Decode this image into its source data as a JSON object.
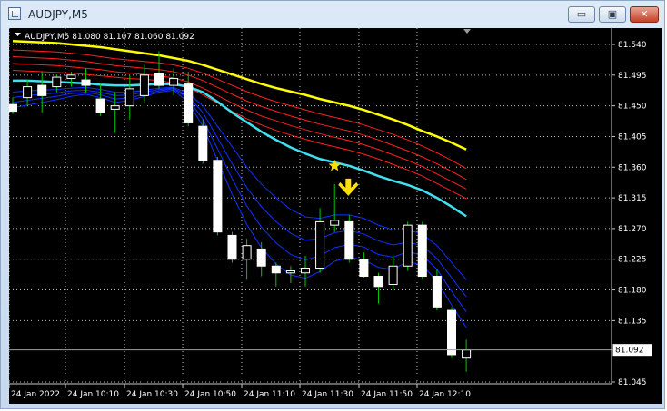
{
  "window": {
    "title": "AUDJPY,M5",
    "minimize_label": "▭",
    "restore_label": "▣",
    "close_label": "✕"
  },
  "chart_data": {
    "type": "candlestick",
    "symbol_label": "AUDJPY,M5",
    "ohlc_label": "81.080 81.107 81.060 81.092",
    "current_price_label": "81.092",
    "current_price": 81.092,
    "y_ticks": [
      "81.540",
      "81.495",
      "81.450",
      "81.405",
      "81.360",
      "81.315",
      "81.270",
      "81.225",
      "81.180",
      "81.135",
      "81.092",
      "81.045"
    ],
    "x_ticks": [
      "24 Jan 2022",
      "24 Jan 10:10",
      "24 Jan 10:30",
      "24 Jan 10:50",
      "24 Jan 11:10",
      "24 Jan 11:30",
      "24 Jan 11:50",
      "24 Jan 12:10"
    ],
    "grid": true,
    "colors": {
      "background": "#000000",
      "grid": "#c0c0c0",
      "candle": "#ffffff",
      "wick": "#00c800",
      "yellow_ma": "#ffff00",
      "cyan_ma": "#40e0f0",
      "red_band": "#ff2020",
      "blue_band": "#1030ff",
      "signal": "#ffe000"
    },
    "candles": [
      {
        "o": 81.452,
        "h": 81.462,
        "l": 81.438,
        "c": 81.442
      },
      {
        "o": 81.462,
        "h": 81.488,
        "l": 81.45,
        "c": 81.478
      },
      {
        "o": 81.48,
        "h": 81.5,
        "l": 81.44,
        "c": 81.465
      },
      {
        "o": 81.478,
        "h": 81.496,
        "l": 81.47,
        "c": 81.492
      },
      {
        "o": 81.49,
        "h": 81.5,
        "l": 81.478,
        "c": 81.495
      },
      {
        "o": 81.488,
        "h": 81.505,
        "l": 81.47,
        "c": 81.48
      },
      {
        "o": 81.46,
        "h": 81.482,
        "l": 81.435,
        "c": 81.44
      },
      {
        "o": 81.445,
        "h": 81.47,
        "l": 81.41,
        "c": 81.45
      },
      {
        "o": 81.45,
        "h": 81.495,
        "l": 81.43,
        "c": 81.475
      },
      {
        "o": 81.465,
        "h": 81.51,
        "l": 81.455,
        "c": 81.495
      },
      {
        "o": 81.498,
        "h": 81.53,
        "l": 81.475,
        "c": 81.48
      },
      {
        "o": 81.48,
        "h": 81.505,
        "l": 81.465,
        "c": 81.49
      },
      {
        "o": 81.482,
        "h": 81.5,
        "l": 81.42,
        "c": 81.425
      },
      {
        "o": 81.42,
        "h": 81.43,
        "l": 81.365,
        "c": 81.37
      },
      {
        "o": 81.37,
        "h": 81.375,
        "l": 81.26,
        "c": 81.265
      },
      {
        "o": 81.26,
        "h": 81.265,
        "l": 81.22,
        "c": 81.225
      },
      {
        "o": 81.225,
        "h": 81.255,
        "l": 81.195,
        "c": 81.245
      },
      {
        "o": 81.24,
        "h": 81.25,
        "l": 81.2,
        "c": 81.215
      },
      {
        "o": 81.215,
        "h": 81.22,
        "l": 81.185,
        "c": 81.205
      },
      {
        "o": 81.205,
        "h": 81.215,
        "l": 81.19,
        "c": 81.208
      },
      {
        "o": 81.205,
        "h": 81.23,
        "l": 81.185,
        "c": 81.212
      },
      {
        "o": 81.212,
        "h": 81.3,
        "l": 81.205,
        "c": 81.28
      },
      {
        "o": 81.275,
        "h": 81.335,
        "l": 81.265,
        "c": 81.282
      },
      {
        "o": 81.28,
        "h": 81.29,
        "l": 81.22,
        "c": 81.225
      },
      {
        "o": 81.225,
        "h": 81.235,
        "l": 81.198,
        "c": 81.2
      },
      {
        "o": 81.2,
        "h": 81.205,
        "l": 81.16,
        "c": 81.185
      },
      {
        "o": 81.188,
        "h": 81.23,
        "l": 81.18,
        "c": 81.215
      },
      {
        "o": 81.215,
        "h": 81.28,
        "l": 81.208,
        "c": 81.275
      },
      {
        "o": 81.275,
        "h": 81.28,
        "l": 81.195,
        "c": 81.2
      },
      {
        "o": 81.2,
        "h": 81.21,
        "l": 81.15,
        "c": 81.155
      },
      {
        "o": 81.15,
        "h": 81.155,
        "l": 81.08,
        "c": 81.085
      },
      {
        "o": 81.08,
        "h": 81.107,
        "l": 81.06,
        "c": 81.092
      }
    ],
    "yellow_ma": [
      81.545,
      81.544,
      81.543,
      81.542,
      81.54,
      81.538,
      81.536,
      81.533,
      81.53,
      81.527,
      81.524,
      81.52,
      81.516,
      81.51,
      81.503,
      81.496,
      81.489,
      81.482,
      81.476,
      81.471,
      81.466,
      81.46,
      81.455,
      81.45,
      81.444,
      81.437,
      81.43,
      81.422,
      81.413,
      81.405,
      81.396,
      81.386
    ],
    "cyan_ma": [
      81.487,
      81.487,
      81.486,
      81.485,
      81.484,
      81.483,
      81.481,
      81.48,
      81.48,
      81.481,
      81.482,
      81.482,
      81.478,
      81.47,
      81.456,
      81.44,
      81.426,
      81.412,
      81.4,
      81.389,
      81.38,
      81.372,
      81.367,
      81.362,
      81.355,
      81.347,
      81.34,
      81.334,
      81.326,
      81.315,
      81.302,
      81.288
    ],
    "red_bands": [
      [
        81.532,
        81.531,
        81.53,
        81.529,
        81.527,
        81.525,
        81.522,
        81.519,
        81.517,
        81.515,
        81.513,
        81.51,
        81.505,
        81.498,
        81.489,
        81.48,
        81.471,
        81.463,
        81.456,
        81.45,
        81.444,
        81.438,
        81.433,
        81.428,
        81.422,
        81.415,
        81.408,
        81.4,
        81.391,
        81.381,
        81.37,
        81.358
      ],
      [
        81.522,
        81.521,
        81.52,
        81.519,
        81.517,
        81.515,
        81.512,
        81.509,
        81.507,
        81.505,
        81.503,
        81.5,
        81.495,
        81.487,
        81.477,
        81.467,
        81.457,
        81.449,
        81.442,
        81.435,
        81.429,
        81.423,
        81.418,
        81.413,
        81.407,
        81.4,
        81.392,
        81.384,
        81.375,
        81.365,
        81.354,
        81.342
      ],
      [
        81.512,
        81.511,
        81.51,
        81.509,
        81.507,
        81.505,
        81.503,
        81.5,
        81.498,
        81.496,
        81.494,
        81.491,
        81.485,
        81.476,
        81.465,
        81.454,
        81.444,
        81.435,
        81.428,
        81.421,
        81.415,
        81.409,
        81.404,
        81.399,
        81.393,
        81.386,
        81.378,
        81.37,
        81.361,
        81.35,
        81.339,
        81.328
      ],
      [
        81.502,
        81.501,
        81.5,
        81.499,
        81.498,
        81.496,
        81.494,
        81.492,
        81.49,
        81.489,
        81.487,
        81.484,
        81.477,
        81.466,
        81.454,
        81.442,
        81.431,
        81.422,
        81.414,
        81.407,
        81.401,
        81.395,
        81.39,
        81.385,
        81.379,
        81.372,
        81.364,
        81.356,
        81.347,
        81.336,
        81.325,
        81.314
      ]
    ],
    "blue_bands": [
      [
        81.47,
        81.472,
        81.473,
        81.474,
        81.476,
        81.477,
        81.474,
        81.47,
        81.47,
        81.473,
        81.476,
        81.477,
        81.468,
        81.45,
        81.42,
        81.39,
        81.36,
        81.335,
        81.315,
        81.298,
        81.287,
        81.285,
        81.29,
        81.29,
        81.285,
        81.275,
        81.268,
        81.268,
        81.262,
        81.245,
        81.22,
        81.195
      ],
      [
        81.462,
        81.465,
        81.467,
        81.469,
        81.472,
        81.473,
        81.47,
        81.465,
        81.466,
        81.47,
        81.474,
        81.476,
        81.464,
        81.44,
        81.403,
        81.365,
        81.33,
        81.302,
        81.28,
        81.263,
        81.253,
        81.255,
        81.264,
        81.267,
        81.262,
        81.252,
        81.246,
        81.25,
        81.245,
        81.226,
        81.198,
        81.17
      ],
      [
        81.455,
        81.458,
        81.461,
        81.464,
        81.468,
        81.47,
        81.466,
        81.46,
        81.462,
        81.467,
        81.472,
        81.475,
        81.46,
        81.43,
        81.387,
        81.343,
        81.303,
        81.272,
        81.249,
        81.232,
        81.224,
        81.23,
        81.242,
        81.247,
        81.243,
        81.232,
        81.228,
        81.236,
        81.231,
        81.21,
        81.178,
        81.148
      ],
      [
        81.447,
        81.451,
        81.455,
        81.459,
        81.464,
        81.467,
        81.462,
        81.455,
        81.458,
        81.464,
        81.47,
        81.473,
        81.455,
        81.42,
        81.37,
        81.32,
        81.276,
        81.242,
        81.218,
        81.202,
        81.197,
        81.207,
        81.222,
        81.228,
        81.224,
        81.213,
        81.21,
        81.222,
        81.216,
        81.193,
        81.158,
        81.125
      ]
    ],
    "star_marker": {
      "index": 22,
      "price": 81.362
    },
    "arrow_marker": {
      "index": 23,
      "direction": "down"
    }
  }
}
